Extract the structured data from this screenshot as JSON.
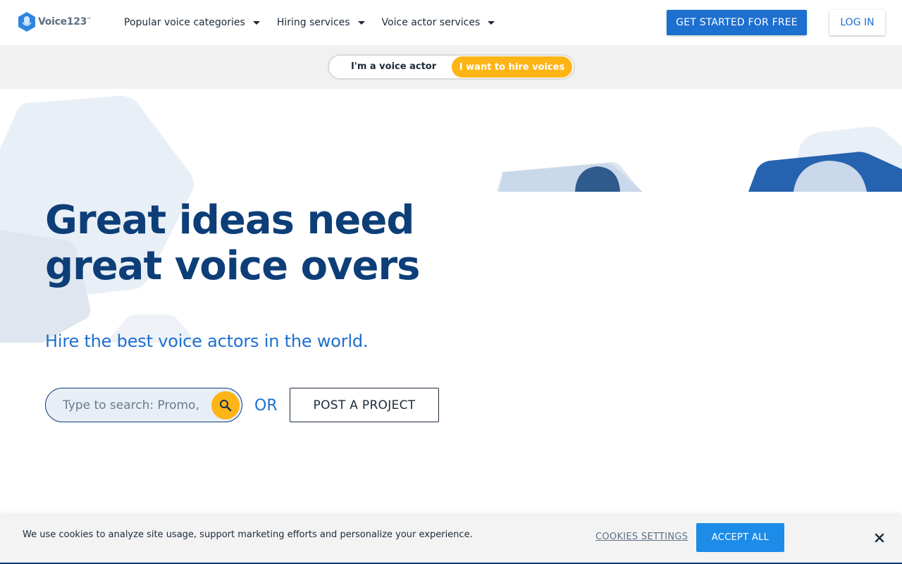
{
  "header": {
    "logo_text": "Voice123",
    "logo_tm": "™",
    "nav": [
      {
        "label": "Popular voice categories"
      },
      {
        "label": "Hiring services"
      },
      {
        "label": "Voice actor services"
      }
    ],
    "get_started_label": "GET STARTED FOR FREE",
    "login_label": "LOG IN"
  },
  "toggle": {
    "actor_label": "I'm a voice actor",
    "hire_label": "I want to hire voices",
    "selected": "hire"
  },
  "hero": {
    "title_line1": "Great ideas need",
    "title_line2": "great voice overs",
    "subtitle": "Hire the best voice actors in the world.",
    "search_placeholder": "Type to search: Promo, Narration, etc.",
    "or_label": "OR",
    "post_project_label": "POST A PROJECT"
  },
  "cookie": {
    "text": "We use cookies to analyze site usage, support marketing efforts and personalize your experience.",
    "settings_label": "COOKIES SETTINGS",
    "accept_label": "ACCEPT ALL"
  },
  "colors": {
    "brand_blue": "#1d6fd0",
    "navy": "#0d3e78",
    "accent_yellow": "#fdb515"
  },
  "icons": {
    "logo": "microphone-bubble-icon",
    "search": "search-icon",
    "close": "close-icon",
    "caret": "caret-down-icon"
  }
}
